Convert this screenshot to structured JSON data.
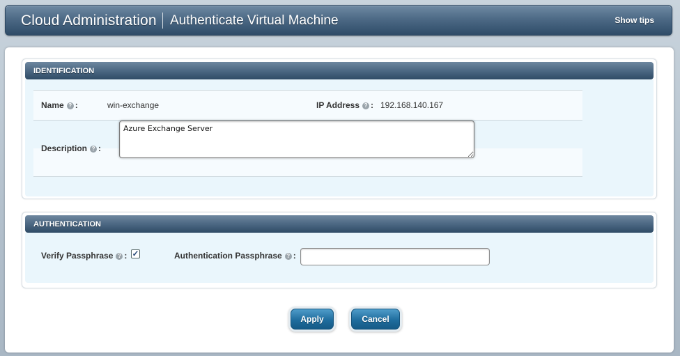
{
  "header": {
    "app_title": "Cloud Administration",
    "page_title": "Authenticate Virtual Machine",
    "show_tips": "Show tips"
  },
  "identification": {
    "title": "IDENTIFICATION",
    "name_label": "Name",
    "name_value": "win-exchange",
    "ip_label": "IP Address",
    "ip_value": "192.168.140.167",
    "description_label": "Description",
    "description_value": "Azure Exchange Server"
  },
  "authentication": {
    "title": "AUTHENTICATION",
    "verify_label": "Verify Passphrase",
    "verify_checked": true,
    "passphrase_label": "Authentication Passphrase",
    "passphrase_value": ""
  },
  "buttons": {
    "apply": "Apply",
    "cancel": "Cancel"
  },
  "icons": {
    "help": "help-icon",
    "check": "checkmark-icon"
  },
  "colors": {
    "header_dark": "#2f4c68",
    "section_body": "#eaf6fc",
    "button_blue": "#1f6d9e"
  }
}
